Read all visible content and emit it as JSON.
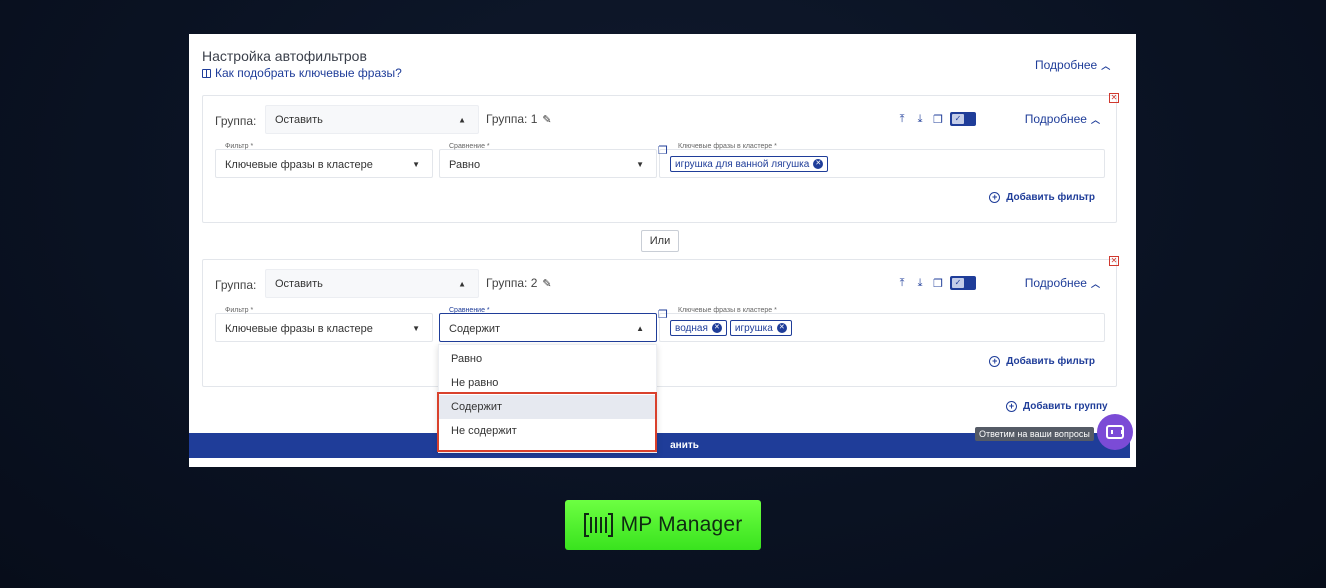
{
  "panel": {
    "title": "Настройка автофильтров",
    "howto_link": "Как подобрать ключевые фразы?",
    "more_label": "Подробнее"
  },
  "groups": [
    {
      "group_label": "Группа:",
      "action_value": "Оставить",
      "group_name": "Группа: 1",
      "more_label": "Подробнее",
      "filter_label": "Фильтр *",
      "filter_value": "Ключевые фразы в кластере",
      "compare_label": "Сравнение *",
      "compare_value": "Равно",
      "keywords_label": "Ключевые фразы в кластере *",
      "chips": [
        "игрушка для ванной лягушка"
      ],
      "add_filter": "Добавить фильтр"
    },
    {
      "group_label": "Группа:",
      "action_value": "Оставить",
      "group_name": "Группа: 2",
      "more_label": "Подробнее",
      "filter_label": "Фильтр *",
      "filter_value": "Ключевые фразы в кластере",
      "compare_label": "Сравнение *",
      "compare_value": "Содержит",
      "keywords_label": "Ключевые фразы в кластере *",
      "chips": [
        "водная",
        "игрушка"
      ],
      "add_filter": "Добавить фильтр"
    }
  ],
  "or_label": "Или",
  "add_group": "Добавить группу",
  "save_label": "анить",
  "dropdown": {
    "options": [
      "Равно",
      "Не равно",
      "Содержит",
      "Не содержит"
    ],
    "selected": "Содержит"
  },
  "help_tooltip": "Ответим на ваши вопросы",
  "brand": {
    "name": "MP Manager",
    "accent": "#1f3d99",
    "logo_bg": "#4cf02a",
    "highlight": "#d9412c"
  }
}
